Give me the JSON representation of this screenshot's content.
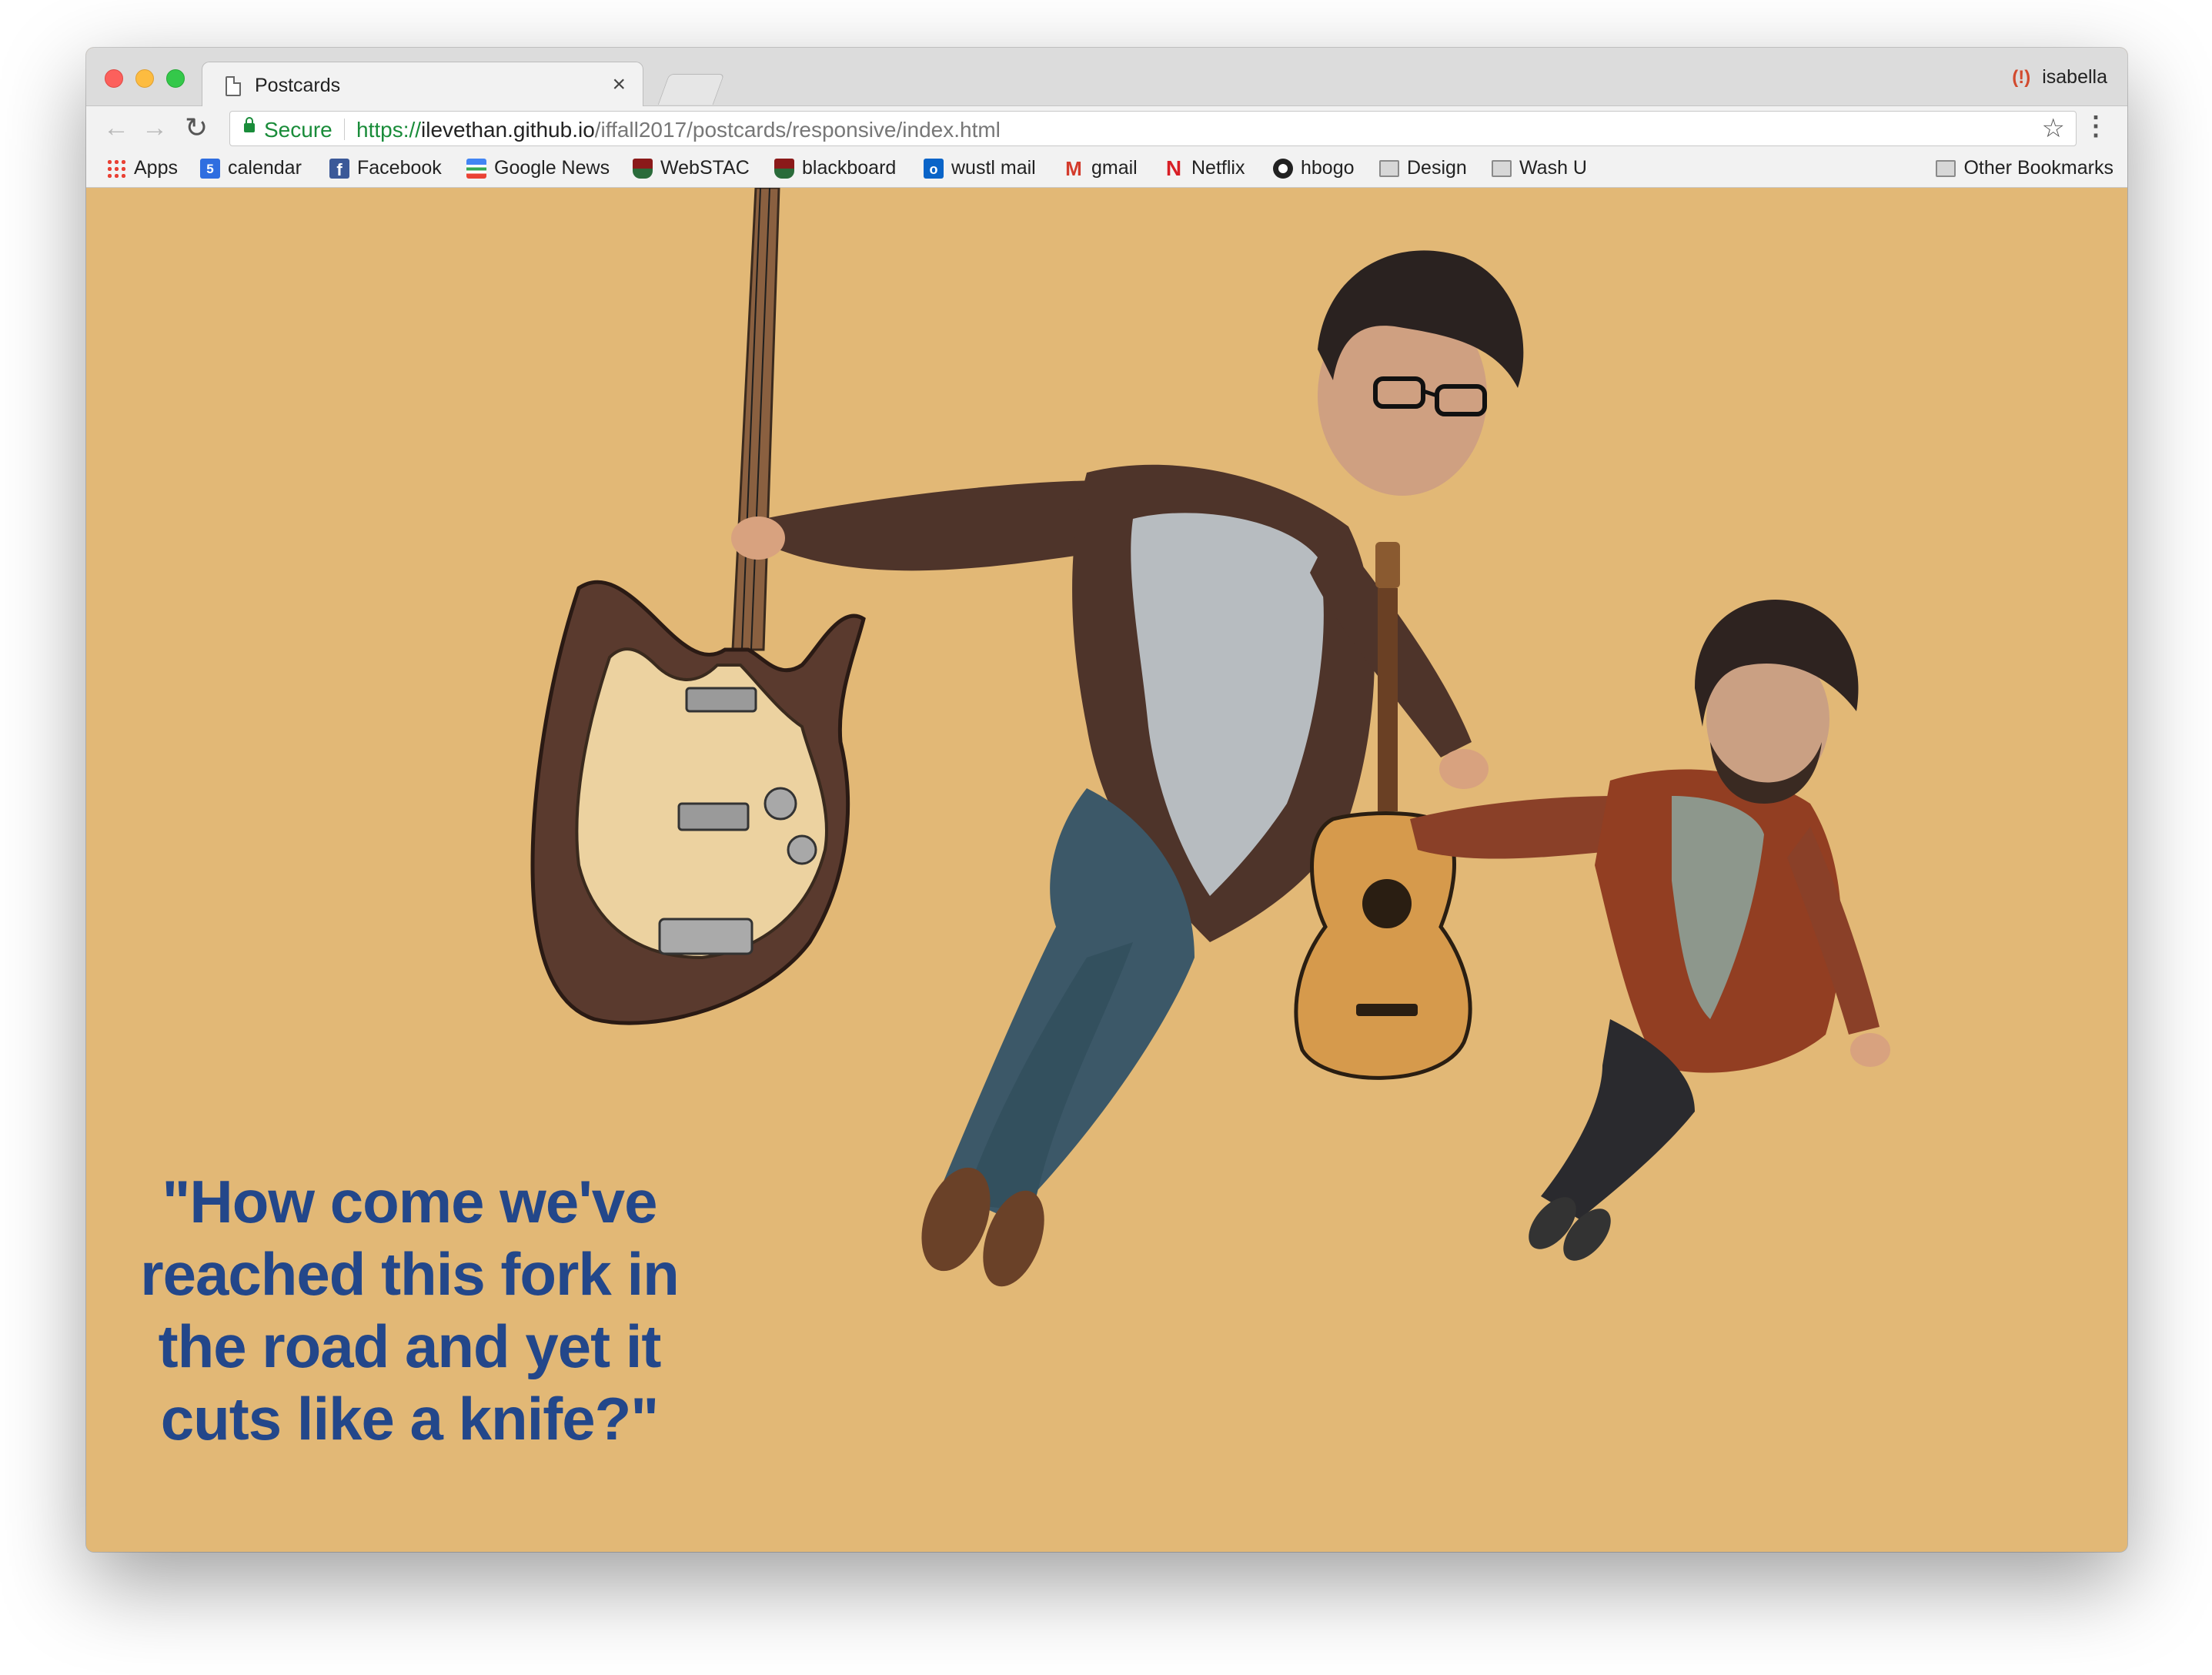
{
  "browser": {
    "tab_title": "Postcards",
    "tab_close": "×",
    "profile_name": "isabella",
    "security_label": "Secure",
    "url_scheme": "https://",
    "url_host": "ilevethan.github.io",
    "url_path": "/iffall2017/postcards/responsive/index.html"
  },
  "bookmarks": {
    "items": [
      {
        "label": "Apps",
        "icon": "apps-grid-icon"
      },
      {
        "label": "calendar",
        "icon": "calendar-icon"
      },
      {
        "label": "Facebook",
        "icon": "facebook-icon"
      },
      {
        "label": "Google News",
        "icon": "google-news-icon"
      },
      {
        "label": "WebSTAC",
        "icon": "shield-icon"
      },
      {
        "label": "blackboard",
        "icon": "shield-icon"
      },
      {
        "label": "wustl mail",
        "icon": "outlook-icon"
      },
      {
        "label": "gmail",
        "icon": "gmail-icon"
      },
      {
        "label": "Netflix",
        "icon": "netflix-icon"
      },
      {
        "label": "hbogo",
        "icon": "hbo-icon"
      },
      {
        "label": "Design",
        "icon": "folder-icon"
      },
      {
        "label": "Wash U",
        "icon": "folder-icon"
      }
    ],
    "other": "Other Bookmarks"
  },
  "page": {
    "background": "#e2b876",
    "quote": "\"How come we've reached this fork in the road and yet it cuts like a knife?\"",
    "quote_color": "#23478a"
  }
}
